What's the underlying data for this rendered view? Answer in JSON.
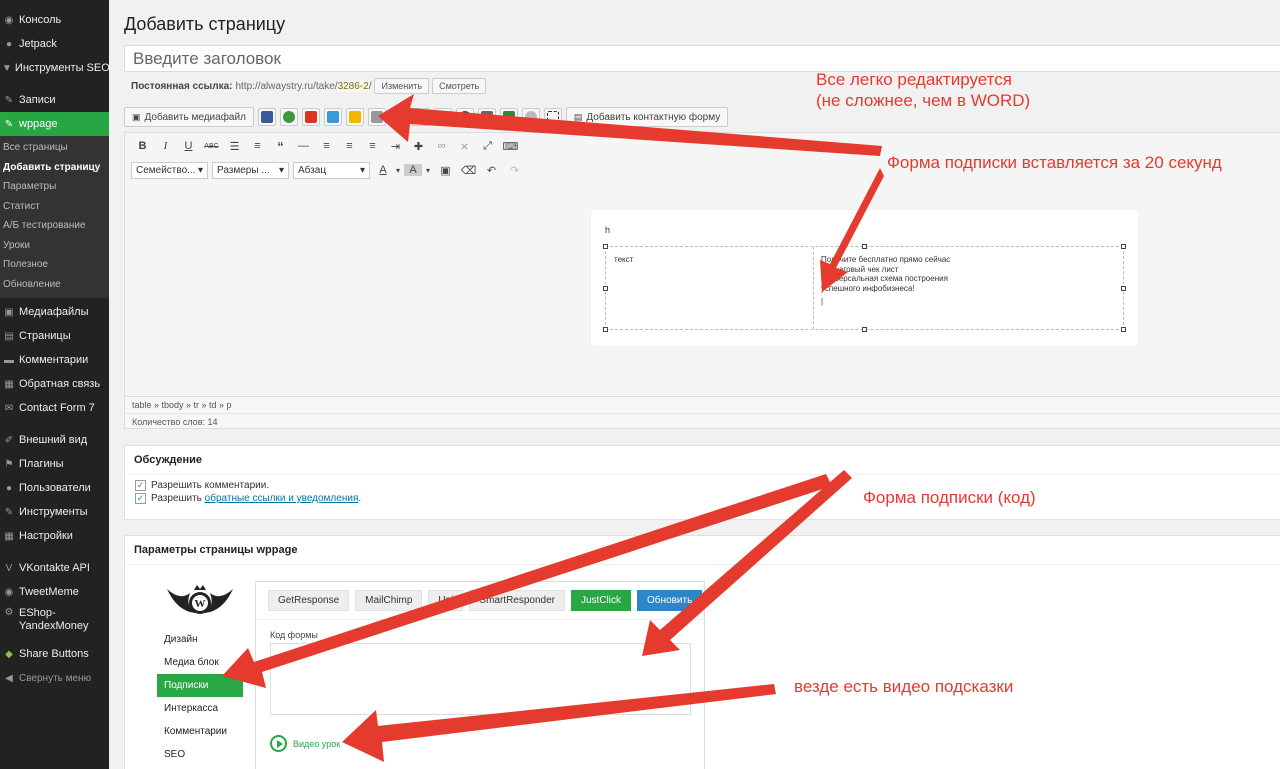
{
  "sidebar": {
    "top": [
      {
        "label": "Консоль",
        "icon": "dashboard-icon"
      },
      {
        "label": "Jetpack",
        "icon": "jetpack-icon"
      },
      {
        "label": "Инструменты SEO",
        "icon": "seo-icon"
      }
    ],
    "zapisi": {
      "label": "Записи",
      "icon": "pin-icon"
    },
    "active": {
      "label": "wppage",
      "icon": "pin-icon"
    },
    "submenu": [
      "Все страницы",
      "Добавить страницу",
      "Параметры",
      "Статист",
      "А/Б тестирование",
      "Уроки",
      "Полезное",
      "Обновление"
    ],
    "items": [
      {
        "label": "Медиафайлы",
        "icon": "media-icon"
      },
      {
        "label": "Страницы",
        "icon": "pages-icon"
      },
      {
        "label": "Комментарии",
        "icon": "comments-icon"
      },
      {
        "label": "Обратная связь",
        "icon": "feedback-icon"
      },
      {
        "label": "Contact Form 7",
        "icon": "mail-icon"
      }
    ],
    "items2": [
      {
        "label": "Внешний вид",
        "icon": "appearance-icon"
      },
      {
        "label": "Плагины",
        "icon": "plugins-icon"
      },
      {
        "label": "Пользователи",
        "icon": "users-icon"
      },
      {
        "label": "Инструменты",
        "icon": "tools-icon"
      },
      {
        "label": "Настройки",
        "icon": "settings-icon"
      }
    ],
    "items3": [
      {
        "label": "VKontakte API",
        "icon": "vk-icon"
      },
      {
        "label": "TweetMeme",
        "icon": "tweetmeme-icon"
      },
      {
        "label": "EShop-YandexMoney",
        "icon": "eshop-icon"
      },
      {
        "label": "Share Buttons",
        "icon": "share-icon"
      },
      {
        "label": "Свернуть меню",
        "icon": "collapse-icon"
      }
    ]
  },
  "page": {
    "title": "Добавить страницу",
    "title_placeholder": "Введите заголовок",
    "permalink_label": "Постоянная ссылка:",
    "permalink_base": "http://alwaystry.ru/take/",
    "permalink_slug": "3286-2",
    "permalink_end": "/",
    "edit_btn": "Изменить",
    "view_btn": "Смотреть"
  },
  "media": {
    "add_media": "Добавить медиафайл",
    "add_contact_form": "Добавить контактную форму"
  },
  "editor": {
    "font_family": "Семейство...",
    "font_size": "Размеры ...",
    "paragraph": "Абзац",
    "content_h": "h",
    "cell1": "текст",
    "cell2_lines": [
      "Получите бесплатно прямо сейчас",
      "10-шаговый чек лист",
      "Универсальная схема построения",
      "успешного инфобизнеса!"
    ],
    "path": "table » tbody » tr » td » p",
    "word_count": "Количество слов: 14"
  },
  "discussion": {
    "title": "Обсуждение",
    "allow_comments": "Разрешить комментарии.",
    "allow_pings_prefix": "Разрешить ",
    "allow_pings_link": "обратные ссылки и уведомления",
    "allow_pings_suffix": "."
  },
  "wppage": {
    "title": "Параметры страницы wppage",
    "tabs": [
      "Дизайн",
      "Медиа блок",
      "Подписки",
      "Интеркасса",
      "Комментарии",
      "SEO"
    ],
    "services": [
      "GetResponse",
      "MailChimp",
      "Uni",
      "SmartResponder",
      "JustClick"
    ],
    "update_btn": "Обновить",
    "code_label": "Код формы",
    "video": "Видео урок"
  },
  "annotations": {
    "a1_line1": "Все легко редактируется",
    "a1_line2": "(не сложнее, чем в WORD)",
    "a2": "Форма подписки вставляется за 20 секунд",
    "a3": "Форма подписки (код)",
    "a4": "везде есть видео подсказки",
    "color": "#e53a2e"
  }
}
